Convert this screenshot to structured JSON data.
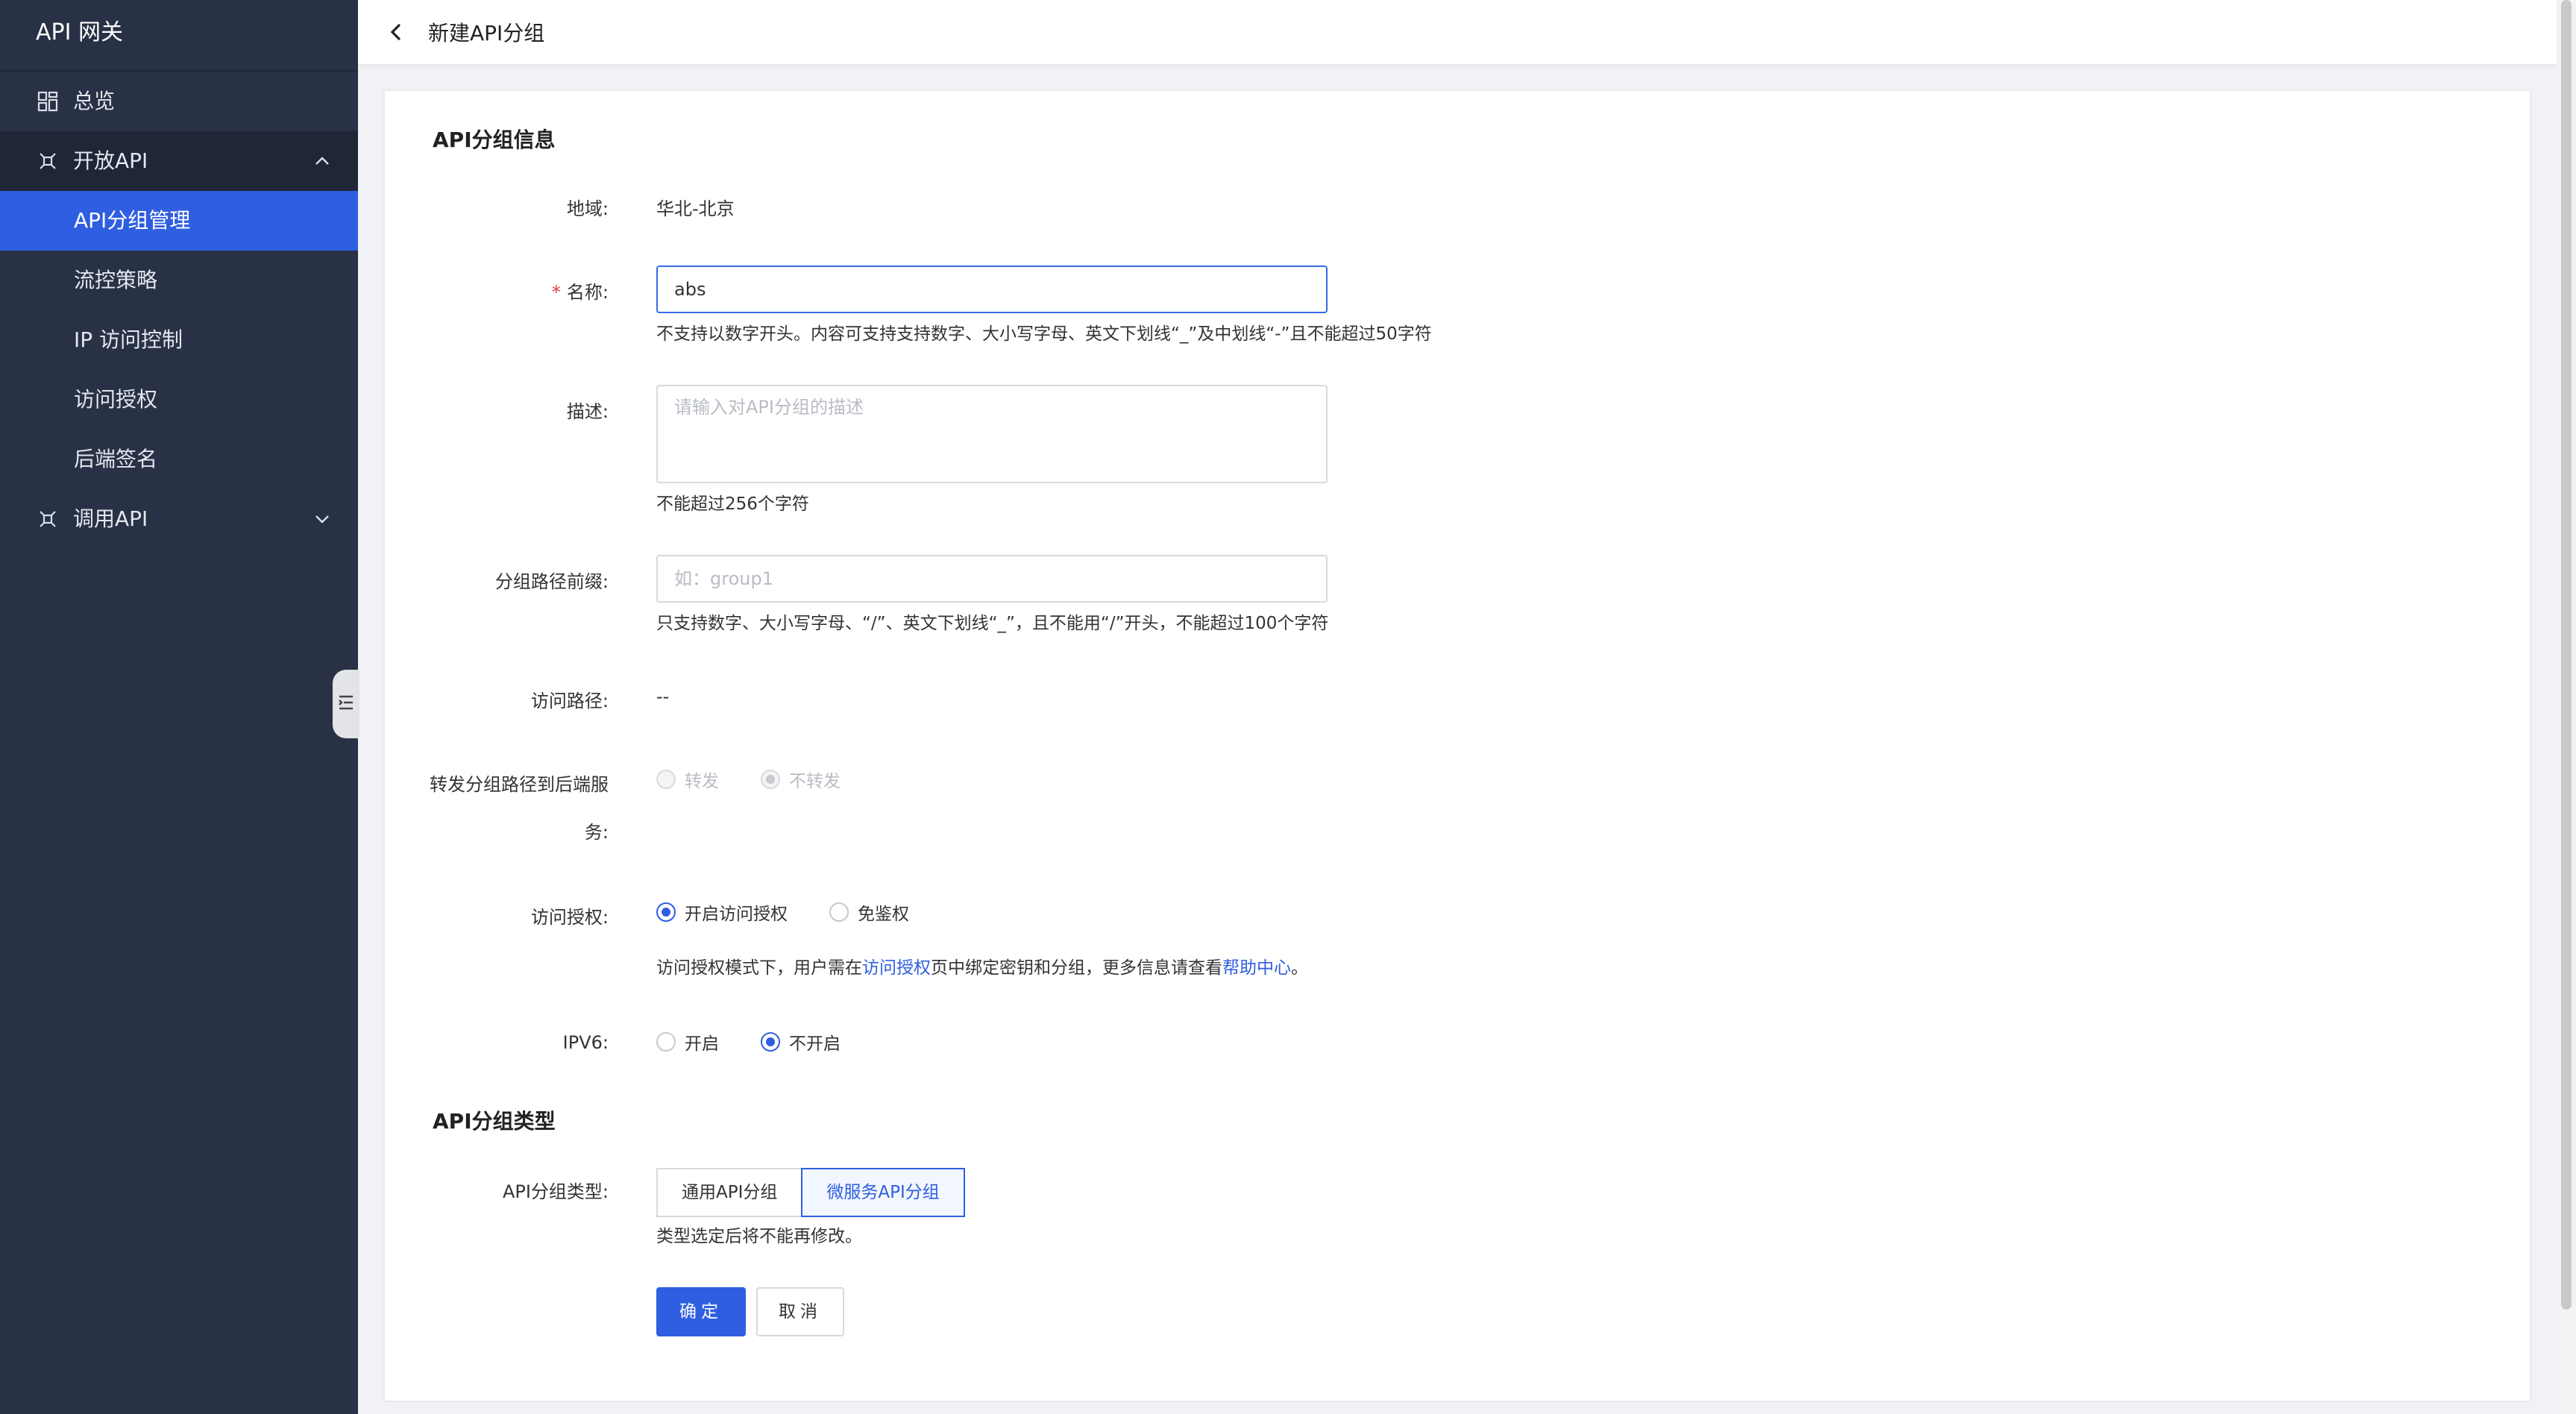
{
  "sidebar": {
    "brand": "API 网关",
    "overview": "总览",
    "open_api": "开放API",
    "open_api_items": [
      "API分组管理",
      "流控策略",
      "IP 访问控制",
      "访问授权",
      "后端签名"
    ],
    "call_api": "调用API"
  },
  "header": {
    "title": "新建API分组"
  },
  "form": {
    "section_info": "API分组信息",
    "region_label": "地域:",
    "region_value": "华北-北京",
    "name_label": "名称:",
    "name_required": "*",
    "name_value": "abs",
    "name_hint": "不支持以数字开头。内容可支持支持数字、大小写字母、英文下划线“_”及中划线“-”且不能超过50字符",
    "desc_label": "描述:",
    "desc_placeholder": "请输入对API分组的描述",
    "desc_hint": "不能超过256个字符",
    "prefix_label": "分组路径前缀:",
    "prefix_placeholder": "如：group1",
    "prefix_hint": "只支持数字、大小写字母、“/”、英文下划线“_”，且不能用“/”开头，不能超过100个字符",
    "access_path_label": "访问路径:",
    "access_path_value": "--",
    "forward_label_1": "转发分组路径到后端服",
    "forward_label_2": "务:",
    "forward_yes": "转发",
    "forward_no": "不转发",
    "auth_label": "访问授权:",
    "auth_on": "开启访问授权",
    "auth_off": "免鉴权",
    "auth_hint_pre": "访问授权模式下，用户需在",
    "auth_hint_link1": "访问授权",
    "auth_hint_mid": "页中绑定密钥和分组，更多信息请查看",
    "auth_hint_link2": "帮助中心",
    "auth_hint_post": "。",
    "ipv6_label": "IPV6:",
    "ipv6_on": "开启",
    "ipv6_off": "不开启",
    "section_type": "API分组类型",
    "type_label": "API分组类型:",
    "type_general": "通用API分组",
    "type_micro": "微服务API分组",
    "type_hint": "类型选定后将不能再修改。",
    "confirm": "确定",
    "cancel": "取消"
  },
  "colors": {
    "accent": "#2f5ee0",
    "sidebar_bg": "#283145"
  }
}
